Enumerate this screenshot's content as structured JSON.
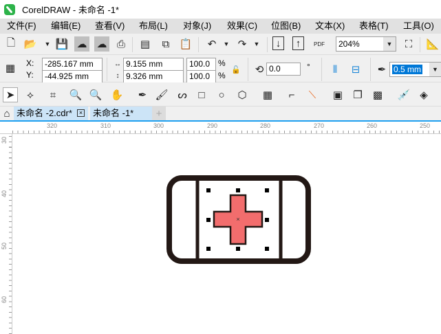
{
  "window": {
    "title": "CorelDRAW - 未命名 -1*"
  },
  "menu": [
    "文件(F)",
    "编辑(E)",
    "查看(V)",
    "布局(L)",
    "对象(J)",
    "效果(C)",
    "位图(B)",
    "文本(X)",
    "表格(T)",
    "工具(O)"
  ],
  "toolbar": {
    "zoom": "204%",
    "pdf_label": "PDF"
  },
  "properties": {
    "x_label": "X:",
    "y_label": "Y:",
    "x": "-285.167 mm",
    "y": "-44.925 mm",
    "width": "9.155 mm",
    "height": "9.326 mm",
    "scale_w": "100.0",
    "scale_h": "100.0",
    "percent": "%",
    "rotation": "0.0",
    "degree": "°",
    "outline": "0.5 mm"
  },
  "tabs": [
    {
      "label": "未命名 -2.cdr*"
    },
    {
      "label": "未命名 -1*"
    }
  ],
  "ruler": {
    "h": [
      "320",
      "310",
      "300",
      "290",
      "280",
      "270",
      "260",
      "250"
    ],
    "v": [
      "30",
      "40",
      "50",
      "60"
    ]
  },
  "colors": {
    "cross_fill": "#f26d6d",
    "accent": "#1ea0f0"
  }
}
